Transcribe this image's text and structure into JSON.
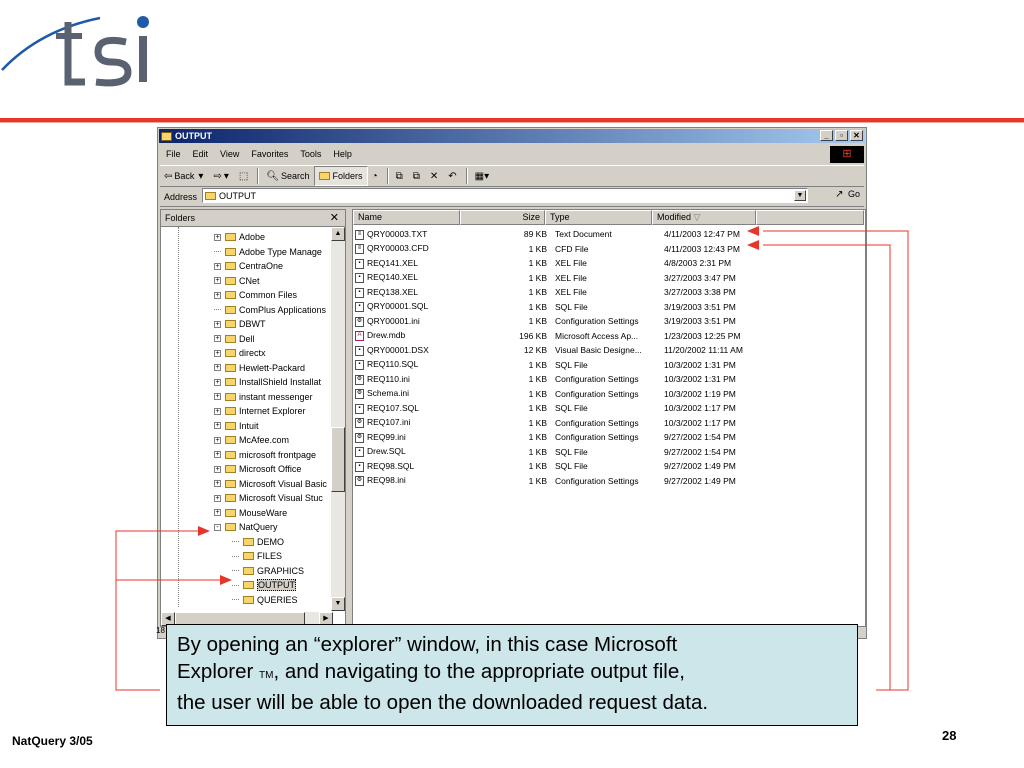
{
  "window": {
    "title": "OUTPUT",
    "menu": [
      "File",
      "Edit",
      "View",
      "Favorites",
      "Tools",
      "Help"
    ],
    "toolbar": {
      "back": "Back",
      "search": "Search",
      "folders": "Folders"
    },
    "address_label": "Address",
    "address_value": "OUTPUT",
    "go_label": "Go"
  },
  "folders_pane": {
    "header": "Folders",
    "items": [
      {
        "label": "Adobe",
        "expander": "+"
      },
      {
        "label": "Adobe Type Manage",
        "expander": ""
      },
      {
        "label": "CentraOne",
        "expander": "+"
      },
      {
        "label": "CNet",
        "expander": "+"
      },
      {
        "label": "Common Files",
        "expander": "+"
      },
      {
        "label": "ComPlus Applications",
        "expander": ""
      },
      {
        "label": "DBWT",
        "expander": "+"
      },
      {
        "label": "Dell",
        "expander": "+"
      },
      {
        "label": "directx",
        "expander": "+"
      },
      {
        "label": "Hewlett-Packard",
        "expander": "+"
      },
      {
        "label": "InstallShield Installat",
        "expander": "+"
      },
      {
        "label": "instant messenger",
        "expander": "+"
      },
      {
        "label": "Internet Explorer",
        "expander": "+"
      },
      {
        "label": "Intuit",
        "expander": "+"
      },
      {
        "label": "McAfee.com",
        "expander": "+"
      },
      {
        "label": "microsoft frontpage",
        "expander": "+"
      },
      {
        "label": "Microsoft Office",
        "expander": "+"
      },
      {
        "label": "Microsoft Visual Basic",
        "expander": "+"
      },
      {
        "label": "Microsoft Visual Stuc",
        "expander": "+"
      },
      {
        "label": "MouseWare",
        "expander": "+"
      },
      {
        "label": "NatQuery",
        "expander": "-"
      }
    ],
    "natquery_children": [
      "DEMO",
      "FILES",
      "GRAPHICS",
      "OUTPUT",
      "QUERIES"
    ],
    "selected": "OUTPUT",
    "status_fragment": "18"
  },
  "files_pane": {
    "columns": [
      "Name",
      "Size",
      "Type",
      "Modified"
    ],
    "rows": [
      {
        "name": "QRY00003.TXT",
        "size": "89 KB",
        "type": "Text Document",
        "modified": "4/11/2003 12:47 PM",
        "icon": "txt"
      },
      {
        "name": "QRY00003.CFD",
        "size": "1 KB",
        "type": "CFD File",
        "modified": "4/11/2003 12:43 PM",
        "icon": "txt"
      },
      {
        "name": "REQ141.XEL",
        "size": "1 KB",
        "type": "XEL File",
        "modified": "4/8/2003 2:31 PM",
        "icon": "gen"
      },
      {
        "name": "REQ140.XEL",
        "size": "1 KB",
        "type": "XEL File",
        "modified": "3/27/2003 3:47 PM",
        "icon": "gen"
      },
      {
        "name": "REQ138.XEL",
        "size": "1 KB",
        "type": "XEL File",
        "modified": "3/27/2003 3:38 PM",
        "icon": "gen"
      },
      {
        "name": "QRY00001.SQL",
        "size": "1 KB",
        "type": "SQL File",
        "modified": "3/19/2003 3:51 PM",
        "icon": "gen"
      },
      {
        "name": "QRY00001.ini",
        "size": "1 KB",
        "type": "Configuration Settings",
        "modified": "3/19/2003 3:51 PM",
        "icon": "ini"
      },
      {
        "name": "Drew.mdb",
        "size": "196 KB",
        "type": "Microsoft Access Ap...",
        "modified": "1/23/2003 12:25 PM",
        "icon": "mdb"
      },
      {
        "name": "QRY00001.DSX",
        "size": "12 KB",
        "type": "Visual Basic Designe...",
        "modified": "11/20/2002 11:11 AM",
        "icon": "gen"
      },
      {
        "name": "REQ110.SQL",
        "size": "1 KB",
        "type": "SQL File",
        "modified": "10/3/2002 1:31 PM",
        "icon": "gen"
      },
      {
        "name": "REQ110.ini",
        "size": "1 KB",
        "type": "Configuration Settings",
        "modified": "10/3/2002 1:31 PM",
        "icon": "ini"
      },
      {
        "name": "Schema.ini",
        "size": "1 KB",
        "type": "Configuration Settings",
        "modified": "10/3/2002 1:19 PM",
        "icon": "ini"
      },
      {
        "name": "REQ107.SQL",
        "size": "1 KB",
        "type": "SQL File",
        "modified": "10/3/2002 1:17 PM",
        "icon": "gen"
      },
      {
        "name": "REQ107.ini",
        "size": "1 KB",
        "type": "Configuration Settings",
        "modified": "10/3/2002 1:17 PM",
        "icon": "ini"
      },
      {
        "name": "REQ99.ini",
        "size": "1 KB",
        "type": "Configuration Settings",
        "modified": "9/27/2002 1:54 PM",
        "icon": "ini"
      },
      {
        "name": "Drew.SQL",
        "size": "1 KB",
        "type": "SQL File",
        "modified": "9/27/2002 1:54 PM",
        "icon": "gen"
      },
      {
        "name": "REQ98.SQL",
        "size": "1 KB",
        "type": "SQL File",
        "modified": "9/27/2002 1:49 PM",
        "icon": "gen"
      },
      {
        "name": "REQ98.ini",
        "size": "1 KB",
        "type": "Configuration Settings",
        "modified": "9/27/2002 1:49 PM",
        "icon": "ini"
      }
    ]
  },
  "callout": {
    "text_line1": "By opening an “explorer” window, in this case Microsoft",
    "text_line2a": "Explorer ",
    "tm": "TM",
    "text_line2b": ", and navigating to the appropriate output file,",
    "text_line3": "the user will be able to open the downloaded request data."
  },
  "footer": {
    "left": "NatQuery 3/05",
    "page": "28"
  },
  "colors": {
    "accent_red": "#e8352a",
    "logo_blue": "#1e5aa8",
    "callout_bg": "#cce6ea",
    "title_blue": "#0a246a"
  }
}
